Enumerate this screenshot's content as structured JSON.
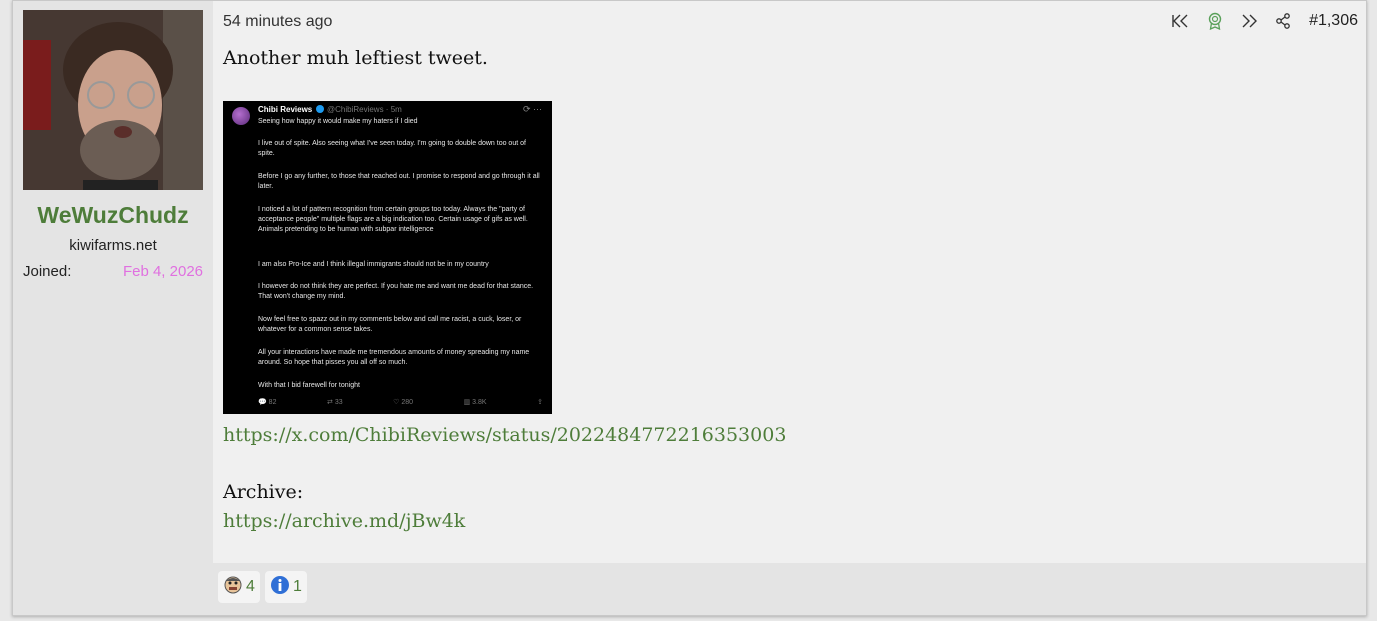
{
  "user": {
    "username": "WeWuzChudz",
    "title": "kiwifarms.net",
    "joined_label": "Joined:",
    "joined_date": "Feb 4, 2026"
  },
  "post": {
    "time": "54 minutes ago",
    "number": "#1,306",
    "text": "Another muh leftiest tweet.",
    "link1": "https://x.com/ChibiReviews/status/2022484772216353003",
    "archive_label": "Archive:",
    "link2": "https://archive.md/jBw4k"
  },
  "tweet": {
    "name": "Chibi Reviews",
    "handle": "@ChibiReviews · 5m",
    "paragraphs": [
      "Seeing how happy it would make my haters if I died",
      "I live out of spite. Also seeing what I've seen today. I'm going to double down too out of spite.",
      "Before I go any further, to those that reached out. I promise to respond and go through it all later.",
      "I noticed a lot of pattern recognition from certain groups too today.  Always the \"party of acceptance people\" multiple flags are a big indication too. Certain usage of gifs as well. Animals pretending to be human with subpar intelligence",
      "I am also Pro-Ice and I think illegal immigrants should not be in my country",
      "I however do not think they are perfect. If you hate me and want me dead for that stance. That won't change my mind.",
      "Now feel free to spazz out in my comments below and call me racist, a cuck, loser, or whatever for a common sense takes.",
      "All your interactions have made me tremendous amounts of money spreading my name around. So hope that pisses you all off so much.",
      "With that I bid farewell for tonight"
    ],
    "replies": "82",
    "retweets": "33",
    "likes": "280",
    "views": "3.8K"
  },
  "reactions": [
    {
      "icon": "face-emoji-icon",
      "count": "4"
    },
    {
      "icon": "info-icon",
      "count": "1"
    }
  ],
  "colors": {
    "accent": "#4e7d3a",
    "joined_date": "#e070e0",
    "award": "#5aa05a"
  }
}
